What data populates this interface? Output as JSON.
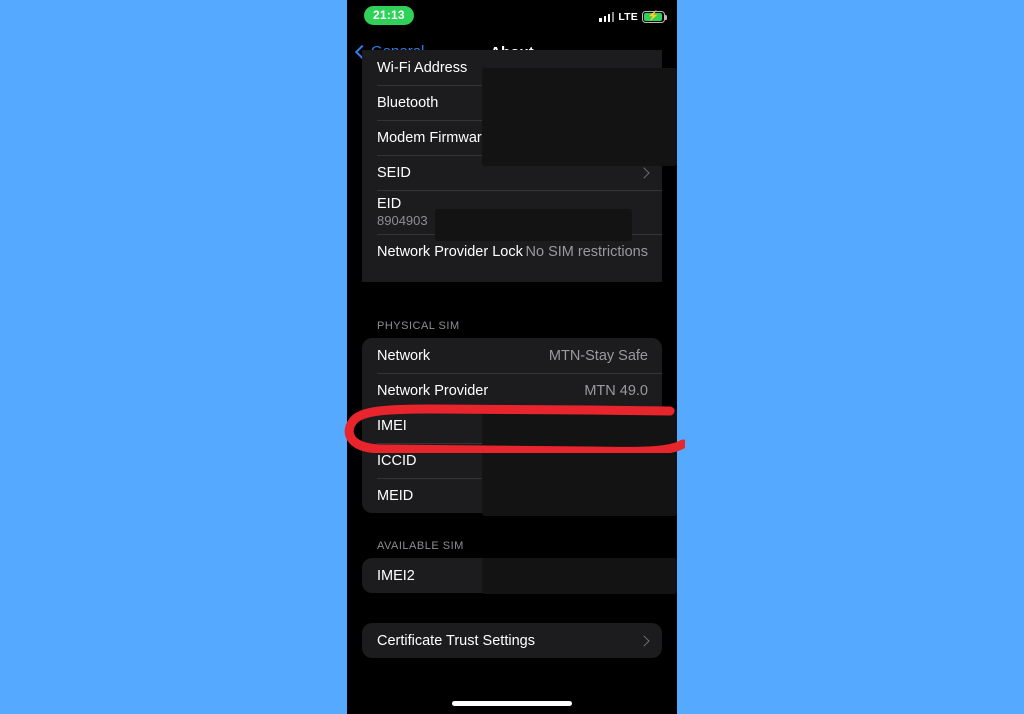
{
  "background_color": "#55aaff",
  "device": {
    "screen_bg": "#000000",
    "card_bg": "#1c1c1e"
  },
  "status_bar": {
    "time": "21:13",
    "time_pill_color": "#30d158",
    "carrier_tech": "LTE",
    "signal_icon": "signal-bars-icon",
    "battery_icon": "battery-charging-icon",
    "battery_color": "#30d158",
    "battery_bolt": "⚡"
  },
  "nav_bar": {
    "back_label": "General",
    "back_icon": "chevron-left-icon",
    "back_color": "#2f7fe8",
    "title": "About"
  },
  "groups": {
    "device_info": {
      "rows": [
        {
          "label": "Wi-Fi Address",
          "value": "",
          "redacted": true
        },
        {
          "label": "Bluetooth",
          "value": "",
          "redacted": true
        },
        {
          "label": "Modem Firmware",
          "value": "",
          "redacted": true
        },
        {
          "label": "SEID",
          "value": "",
          "chevron": true
        },
        {
          "label": "EID",
          "sub": "8904903",
          "value": "",
          "redacted": true
        },
        {
          "label": "Network Provider Lock",
          "value": "No SIM restrictions"
        }
      ]
    },
    "physical_sim": {
      "header": "PHYSICAL SIM",
      "rows": [
        {
          "label": "Network",
          "value": "MTN-Stay Safe"
        },
        {
          "label": "Network Provider",
          "value": "MTN 49.0"
        },
        {
          "label": "IMEI",
          "value": "",
          "redacted": true,
          "highlighted": true
        },
        {
          "label": "ICCID",
          "value": "",
          "redacted": true
        },
        {
          "label": "MEID",
          "value": "",
          "redacted": true
        }
      ]
    },
    "available_sim": {
      "header": "AVAILABLE SIM",
      "rows": [
        {
          "label": "IMEI2",
          "value": "",
          "redacted": true
        }
      ]
    },
    "certificates": {
      "rows": [
        {
          "label": "Certificate Trust Settings",
          "value": "",
          "chevron": true
        }
      ]
    }
  },
  "annotation": {
    "shape": "red-oval-highlight",
    "target": "IMEI",
    "color": "#e8252c",
    "stroke_width": 8
  },
  "home_indicator": {
    "icon": "home-indicator-bar"
  }
}
